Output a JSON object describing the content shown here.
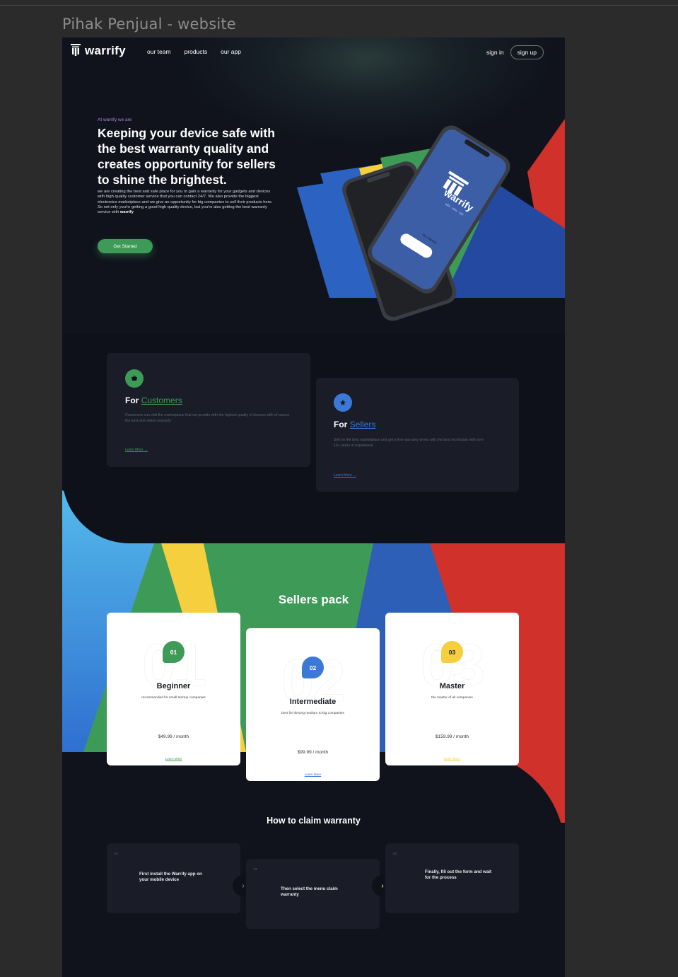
{
  "frame_title": "Pihak Penjual - website",
  "nav": {
    "logo_text": "warrify",
    "links": [
      "our team",
      "products",
      "our app"
    ],
    "sign_in": "sign in",
    "sign_up": "sign up"
  },
  "hero": {
    "eyebrow": "At warrify we are",
    "headline": "Keeping your device safe with the best warranty quality and creates opportunity for sellers to shine the brightest.",
    "body": "we are creating the best and safe place for you to gain a warranty for your gadgets and devices with high quality customer service that you can contact 24/7. We also provide the biggest electronics marketplace and we give an opportunity for big companies to sell their products here. So not only you're getting a good high quality device, but you're also getting the best warranty service with",
    "body_brand": "warrify",
    "cta": "Get Started",
    "phone_logo": "warrify",
    "phone_tagline": "safe · easy · fast",
    "phone_button": "Get Started"
  },
  "audiences": [
    {
      "prefix": "For",
      "name": "Customers",
      "desc": "Customers can visit the marketplace that we provide with the highest quality of devices with of course the best and safest warranty",
      "link": "Learn More →",
      "color": "#3e9b57",
      "icon": "basket-icon"
    },
    {
      "prefix": "For",
      "name": "Sellers",
      "desc": "Sell on the best marketplace and get a free warranty terms with the best technician with over 15+ years of experience",
      "link": "Learn More →",
      "color": "#3b78d8",
      "icon": "badge-icon"
    }
  ],
  "pricing": {
    "title": "Sellers pack",
    "plans": [
      {
        "number": "01",
        "ghost": "01",
        "name": "Beginner",
        "subtitle": "recommended for small startup companies",
        "price": "$49.99 / month",
        "link": "Learn More",
        "color": "#3e9b57",
        "num_text": "#ffffff"
      },
      {
        "number": "02",
        "ghost": "02",
        "name": "Intermediate",
        "subtitle": "best for thriving medium to big companies",
        "price": "$99.99 / month",
        "link": "Learn More",
        "color": "#3b78d8",
        "num_text": "#ffffff"
      },
      {
        "number": "03",
        "ghost": "03",
        "name": "Master",
        "subtitle": "the master of all companies",
        "price": "$159.99 / month",
        "link": "Learn More",
        "color": "#f5cf3d",
        "num_text": "#1b1e25"
      }
    ]
  },
  "claim": {
    "title": "How to claim warranty",
    "steps": [
      {
        "num": "01",
        "text": "First install the Warrify app on your mobile device"
      },
      {
        "num": "02",
        "text": "Then select the menu claim warranty"
      },
      {
        "num": "03",
        "text": "Finally, fill out the form and wait for the process"
      }
    ],
    "arrows": [
      {
        "glyph": "›",
        "color": "#3e9b57",
        "icon": "chevron-right-icon"
      },
      {
        "glyph": "›",
        "color": "#f5cf3d",
        "icon": "chevron-right-icon"
      }
    ]
  },
  "colors": {
    "green": "#3e9b57",
    "blue": "#3b78d8",
    "yellow": "#f5cf3d",
    "red": "#d0322b",
    "background": "#10131c"
  }
}
